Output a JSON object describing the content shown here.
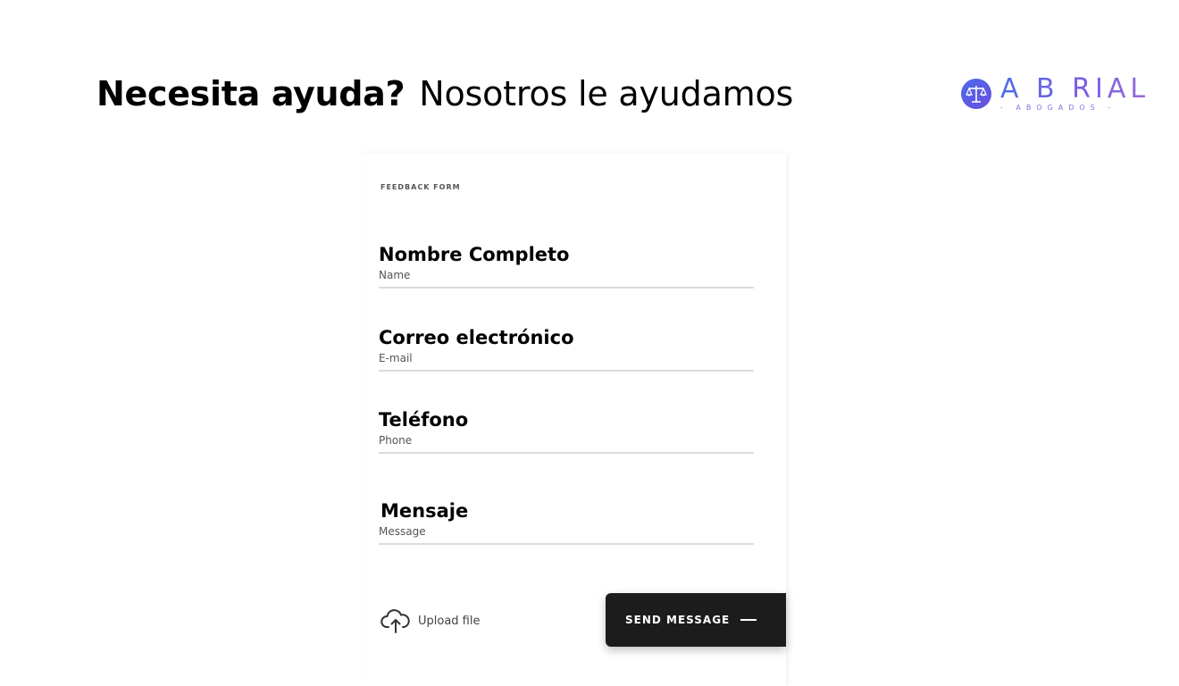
{
  "header": {
    "title_strong": "Necesita ayuda?",
    "title_light": "Nosotros le ayudamos"
  },
  "logo": {
    "wordmark": "A B RIAL",
    "tagline": "- ABOGADOS -",
    "icon": "scales-of-justice-icon",
    "colors": [
      "#4f6de8",
      "#9a6ad8"
    ]
  },
  "form": {
    "tag": "FEEDBACK FORM",
    "fields": [
      {
        "label": "Nombre Completo",
        "placeholder": "Name"
      },
      {
        "label": "Correo electrónico",
        "placeholder": "E-mail"
      },
      {
        "label": "Teléfono",
        "placeholder": "Phone"
      },
      {
        "label": "Mensaje",
        "placeholder": "Message"
      }
    ],
    "upload": {
      "label": "Upload file",
      "icon": "cloud-upload-icon"
    },
    "send": {
      "label": "SEND MESSAGE",
      "icon": "arrow-line-icon",
      "color": "#1c1c1c"
    }
  }
}
